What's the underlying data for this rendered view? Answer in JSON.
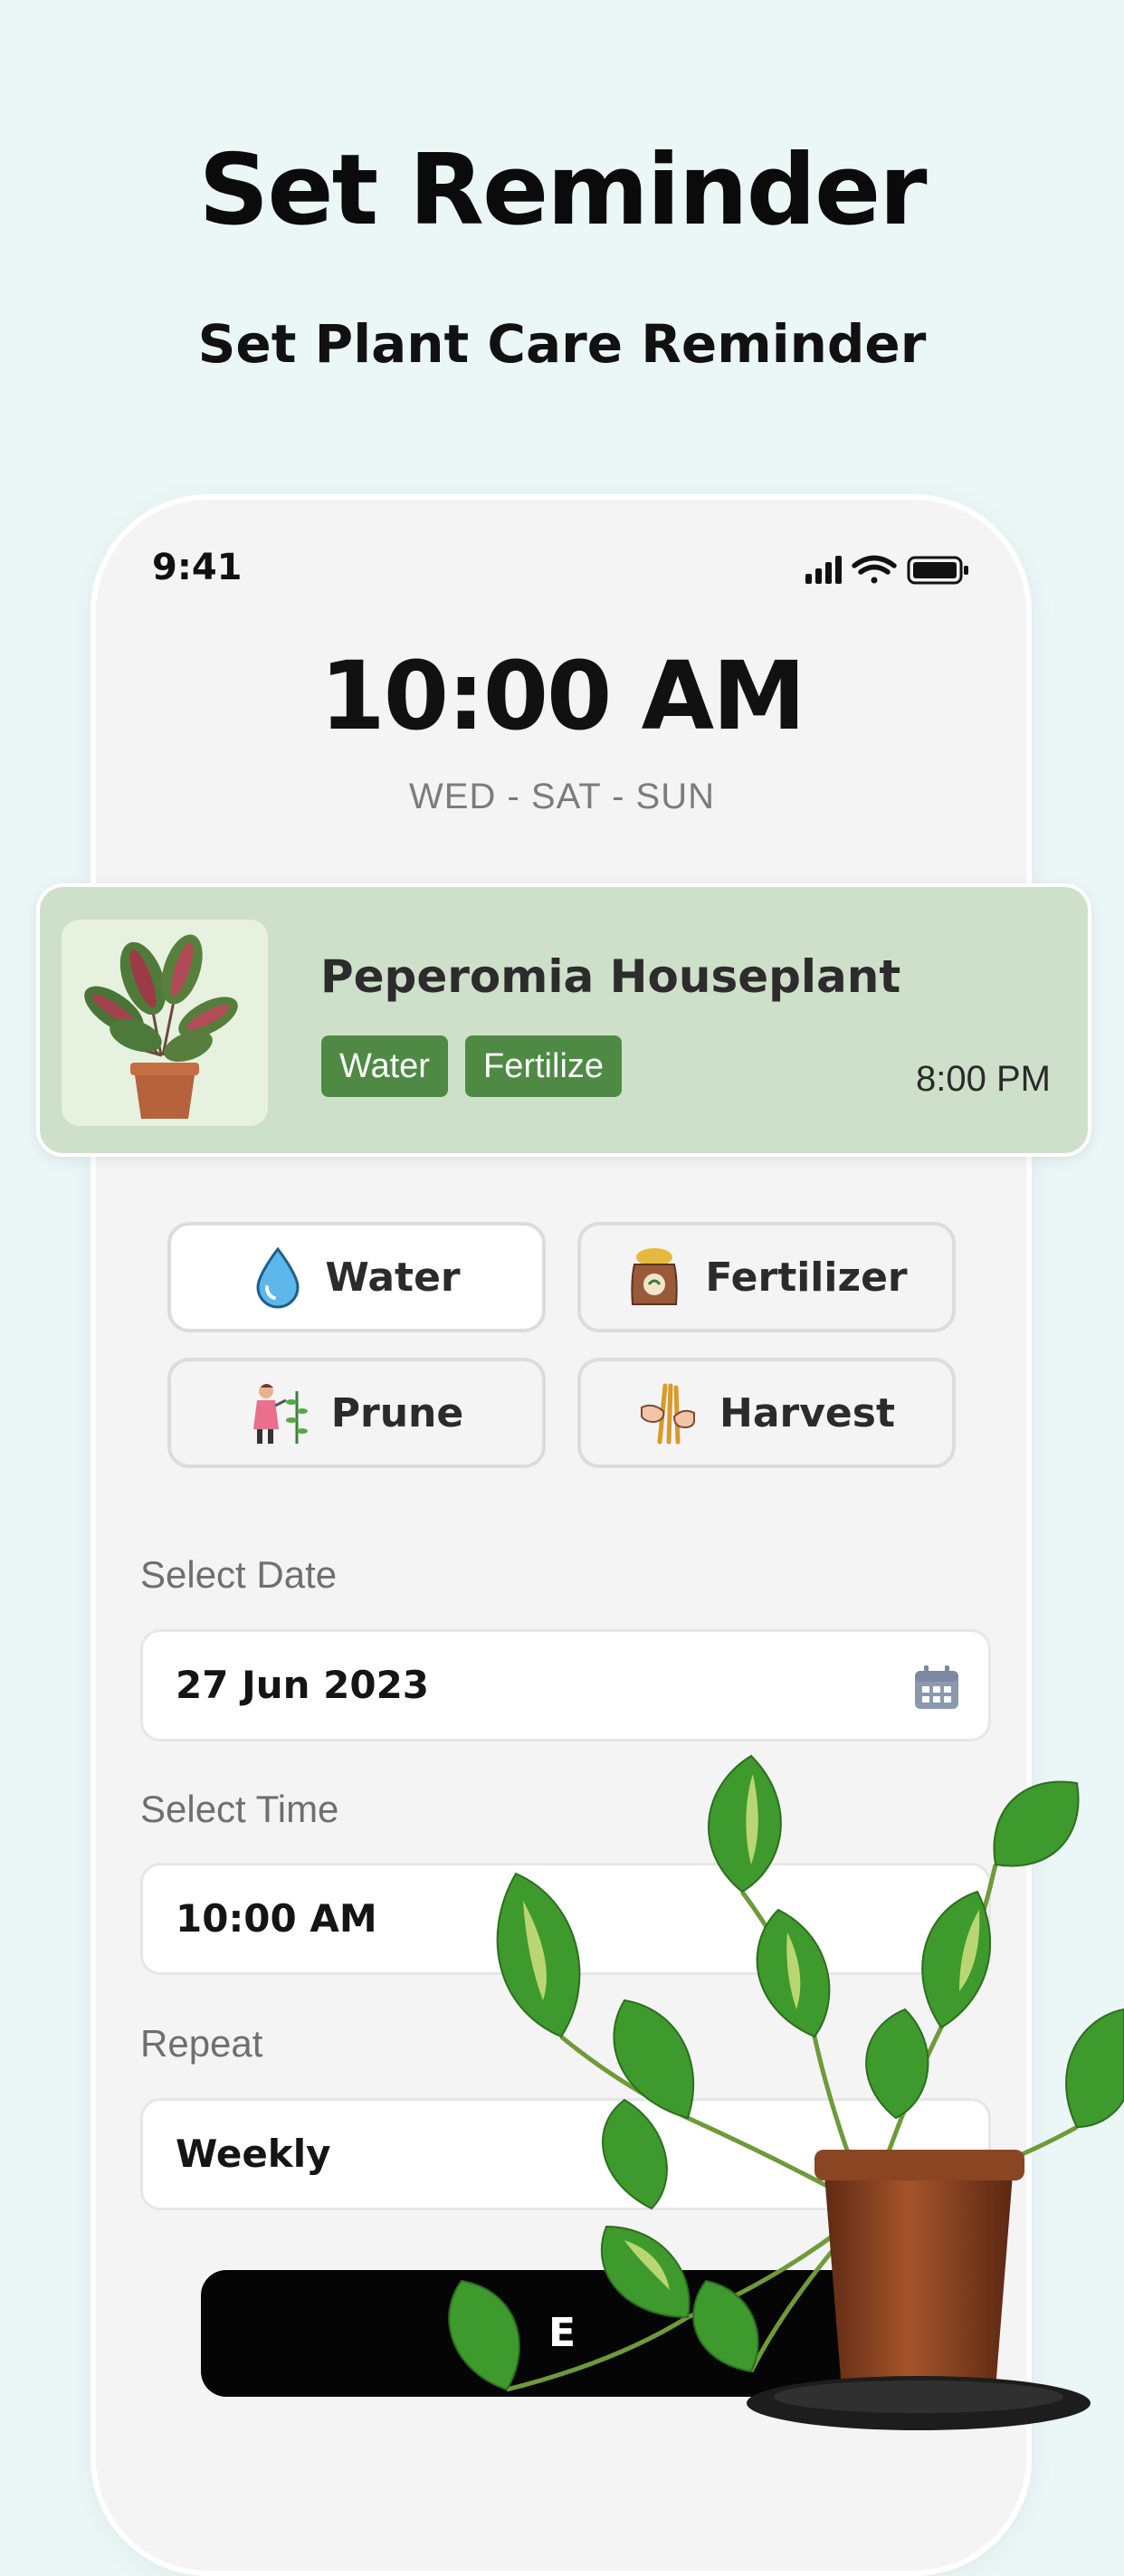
{
  "header": {
    "title": "Set Reminder",
    "subtitle": "Set Plant Care Reminder"
  },
  "status_bar": {
    "time": "9:41",
    "icons": [
      "signal-icon",
      "wifi-icon",
      "battery-icon"
    ]
  },
  "reminder": {
    "time": "10:00 AM",
    "days": "WED - SAT - SUN"
  },
  "plant_card": {
    "name": "Peperomia Houseplant",
    "tags": [
      "Water",
      "Fertilize"
    ],
    "time": "8:00 PM",
    "image": "prayer-plant-photo"
  },
  "care_options": [
    {
      "label": "Water",
      "icon": "water-drop-icon",
      "selected": true
    },
    {
      "label": "Fertilizer",
      "icon": "fertilizer-bag-icon",
      "selected": false
    },
    {
      "label": "Prune",
      "icon": "gardener-pruning-icon",
      "selected": false
    },
    {
      "label": "Harvest",
      "icon": "harvest-hands-icon",
      "selected": false
    }
  ],
  "form": {
    "date_label": "Select Date",
    "date_value": "27 Jun 2023",
    "time_label": "Select Time",
    "time_value": "10:00 AM",
    "repeat_label": "Repeat",
    "repeat_value": "Weekly"
  },
  "save_button": {
    "visible_text": "E"
  },
  "colors": {
    "background": "#ebf6f7",
    "card": "#cfe0ca",
    "tag": "#4e8a43",
    "button": "#050505"
  }
}
